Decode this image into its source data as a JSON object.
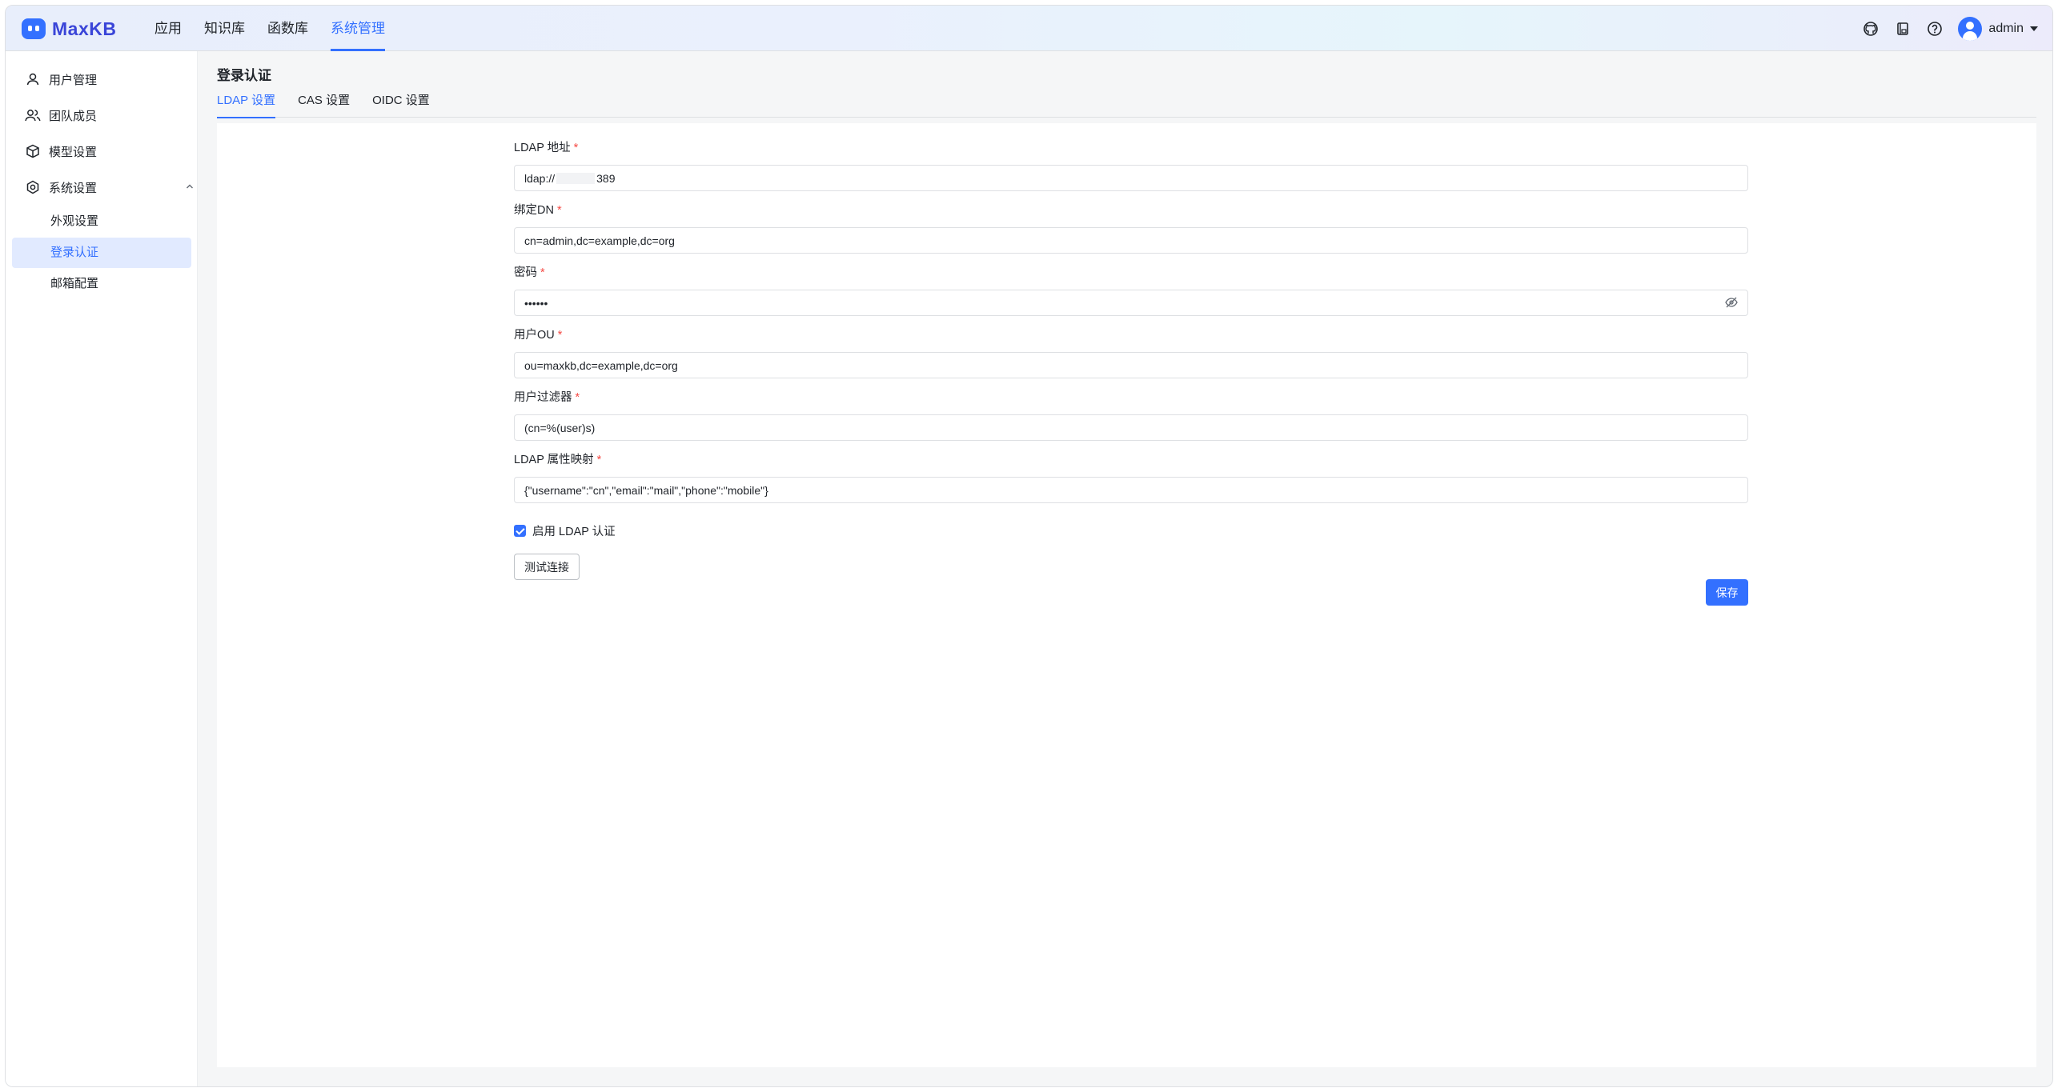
{
  "header": {
    "logo_text": "MaxKB",
    "nav": [
      {
        "label": "应用"
      },
      {
        "label": "知识库"
      },
      {
        "label": "函数库"
      },
      {
        "label": "系统管理",
        "active": true
      }
    ],
    "icons": [
      "github-icon",
      "book-icon",
      "help-icon"
    ],
    "user": {
      "name": "admin"
    }
  },
  "sidebar": {
    "items": [
      {
        "label": "用户管理",
        "icon": "user-icon"
      },
      {
        "label": "团队成员",
        "icon": "team-icon"
      },
      {
        "label": "模型设置",
        "icon": "cube-icon"
      },
      {
        "label": "系统设置",
        "icon": "gear-icon",
        "expanded": true
      }
    ],
    "sub_items": [
      {
        "label": "外观设置"
      },
      {
        "label": "登录认证",
        "active": true
      },
      {
        "label": "邮箱配置"
      }
    ]
  },
  "main": {
    "title": "登录认证",
    "tabs": [
      {
        "label": "LDAP 设置",
        "active": true
      },
      {
        "label": "CAS 设置"
      },
      {
        "label": "OIDC 设置"
      }
    ],
    "form": {
      "ldap_address": {
        "label": "LDAP 地址",
        "value_prefix": "ldap://",
        "value_suffix": "389"
      },
      "bind_dn": {
        "label": "绑定DN",
        "value": "cn=admin,dc=example,dc=org"
      },
      "password": {
        "label": "密码",
        "value": "••••••"
      },
      "user_ou": {
        "label": "用户OU",
        "value": "ou=maxkb,dc=example,dc=org"
      },
      "user_filter": {
        "label": "用户过滤器",
        "value": "(cn=%(user)s)"
      },
      "attr_mapping": {
        "label": "LDAP 属性映射",
        "value": "{\"username\":\"cn\",\"email\":\"mail\",\"phone\":\"mobile\"}"
      },
      "enable_ldap": {
        "label": "启用 LDAP 认证",
        "checked": true
      },
      "test_button": "测试连接",
      "save_button": "保存"
    }
  },
  "colors": {
    "accent": "#3370ff",
    "required": "#f54a45"
  }
}
